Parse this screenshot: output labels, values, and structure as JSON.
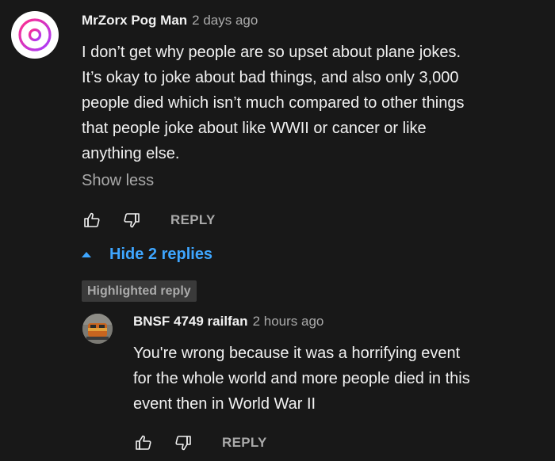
{
  "comment": {
    "author": "MrZorx Pog Man",
    "timestamp": "2 days ago",
    "text": "I don’t get why people are so upset about plane jokes.\nIt’s okay to joke about bad things, and also only 3,000\npeople died which isn’t much compared to other things\nthat people joke about like WWII or cancer or like\nanything else.",
    "show_less_label": "Show less",
    "reply_label": "REPLY",
    "avatar_icon": "pokeball-logo-icon",
    "avatar_colors": [
      "#ff2d8a",
      "#a63bff"
    ]
  },
  "replies_toggle": {
    "label": "Hide 2 replies",
    "icon": "caret-up-icon",
    "color": "#3ea6ff"
  },
  "highlighted_badge": "Highlighted reply",
  "reply": {
    "author": "BNSF 4749 railfan",
    "timestamp": "2 hours ago",
    "text": "You're wrong because it was a horrifying event\nfor the whole world and more people died in this\nevent then in World War II",
    "reply_label": "REPLY",
    "avatar_icon": "locomotive-photo-avatar"
  },
  "icons": {
    "like": "thumbs-up-icon",
    "dislike": "thumbs-down-icon"
  },
  "theme": {
    "background": "#181818",
    "text": "#f1f1f1",
    "muted": "#aaaaaa",
    "badge_bg": "#3a3a3a"
  }
}
